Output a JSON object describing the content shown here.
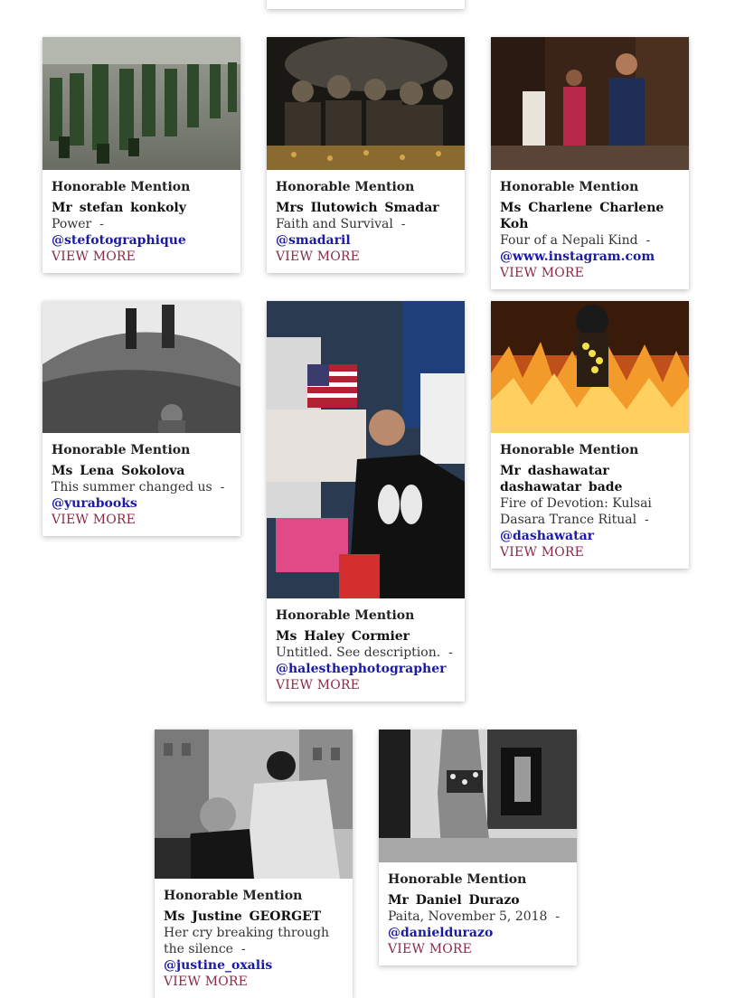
{
  "cards": [
    {
      "award": "Honorable Mention",
      "name": "Mr  stefan  konkoly",
      "title": "Power",
      "handle": "@stefotographique",
      "more": "VIEW MORE"
    },
    {
      "award": "Honorable Mention",
      "name": "Mrs  Ilutowich  Smadar",
      "title": "Faith and Survival",
      "handle": "@smadaril",
      "more": "VIEW MORE"
    },
    {
      "award": "Honorable Mention",
      "name": "Ms  Charlene  Charlene Koh",
      "title": "Four of a Nepali Kind",
      "handle": "@www.instagram.com",
      "more": "VIEW MORE"
    },
    {
      "award": "Honorable Mention",
      "name": "Ms  Lena  Sokolova",
      "title": "This summer changed us",
      "handle": "@yurabooks",
      "more": "VIEW MORE"
    },
    {
      "award": "Honorable Mention",
      "name": "Ms  Haley  Cormier",
      "title": "Untitled. See description.",
      "handle": "@halesthephotographer",
      "more": "VIEW MORE"
    },
    {
      "award": "Honorable Mention",
      "name": "Mr  dashawatar  dashawatar bade",
      "title": "Fire of Devotion: Kulsai Dasara Trance Ritual",
      "handle": "@dashawatar",
      "more": "VIEW MORE"
    },
    {
      "award": "Honorable Mention",
      "name": "Ms  Justine  GEORGET",
      "title": "Her cry breaking through the silence",
      "handle": "@justine_oxalis",
      "more": "VIEW MORE"
    },
    {
      "award": "Honorable Mention",
      "name": "Mr  Daniel  Durazo",
      "title": "Paita, November 5, 2018",
      "handle": "@danieldurazo",
      "more": "VIEW MORE"
    }
  ],
  "separator": "-"
}
